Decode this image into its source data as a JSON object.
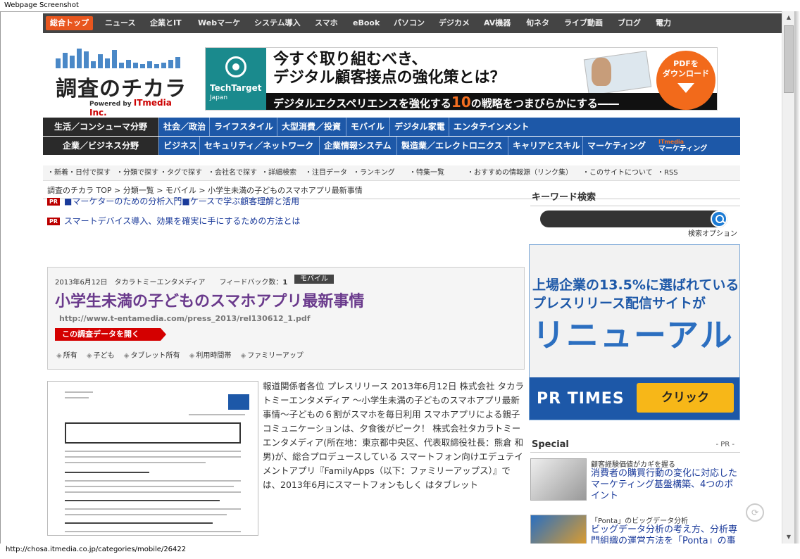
{
  "window": {
    "title": "Webpage Screenshot",
    "status_url": "http://chosa.itmedia.co.jp/categories/mobile/26422"
  },
  "topnav": [
    "総合トップ",
    "ニュース",
    "企業とIT",
    "Webマーケ",
    "システム導入",
    "スマホ",
    "eBook",
    "パソコン",
    "デジカメ",
    "AV機器",
    "旬ネタ",
    "ライブ動画",
    "ブログ",
    "電力"
  ],
  "logo": {
    "name": "調査のチカラ",
    "powered": "Powered by",
    "brand": "ITmedia Inc."
  },
  "banner": {
    "brand": "TechTarget",
    "brand_sub": "Japan",
    "headline1": "今すぐ取り組むべき、",
    "headline2": "デジタル顧客接点の強化策とは？",
    "strip_pre": "デジタルエクスペリエンスを強化する",
    "strip_num": "10",
    "strip_post": "の戦略をつまびらかにする――",
    "pdf_line1": "PDFを",
    "pdf_line2": "ダウンロード"
  },
  "consumer_row": {
    "head": "生活／コンシューマ分野",
    "items": [
      "社会／政治",
      "ライフスタイル",
      "大型消費／投資",
      "モバイル",
      "デジタル家電",
      "エンタテインメント"
    ]
  },
  "business_row": {
    "head": "企業／ビジネス分野",
    "items": [
      "ビジネス",
      "セキュリティ／ネットワーク",
      "企業情報システム",
      "製造業／エレクトロニクス",
      "キャリアとスキル",
      "マーケティング"
    ],
    "logo_top": "ITmedia",
    "logo_bottom": "マーケティング"
  },
  "subnav": [
    "・新着・日付で探す",
    "・分類で探す",
    "・タグで探す",
    "・会社名で探す",
    "・詳細検索",
    "・注目データ",
    "・ランキング",
    "・特集一覧",
    "・おすすめの情報源（リンク集）",
    "・このサイトについて",
    "・RSS"
  ],
  "breadcrumb": "調査のチカラ TOP > 分類一覧 > モバイル > 小学生未満の子どものスマホアプリ最新事情",
  "pr_links": [
    {
      "tag": "PR",
      "text": "■マーケターのための分析入門■ケースで学ぶ顧客理解と活用"
    },
    {
      "tag": "PR",
      "text": "スマートデバイス導入、効果を確実に手にするための方法とは"
    }
  ],
  "article": {
    "date": "2013年6月12日",
    "company": "タカラトミーエンタメディア",
    "feedback_label": "フィードバック数：",
    "feedback_count": "1",
    "category": "モバイル",
    "title": "小学生未満の子どものスマホアプリ最新事情",
    "url": "http://www.t-entamedia.com/press_2013/rel130612_1.pdf",
    "open_button": "この調査データを開く",
    "tags": [
      "所有",
      "子ども",
      "タブレット所有",
      "利用時間帯",
      "ファミリーアップ"
    ],
    "body": "報道関係者各位 プレスリリース 2013年6月12日 株式会社 タカラトミーエンタメディア ～小学生未満の子どものスマホアプリ最新事情～子どもの６割がスマホを毎日利用 スマホアプリによる親子コミュニケーションは、夕食後がピーク！ 株式会社タカラトミーエンタメディア(所在地：東京都中央区、代表取締役社長：熊倉 和男)が、総合プロデュースしている スマートフォン向けエデュテイメントアプリ『FamilyApps（以下：ファミリーアップス）』では、2013年6月にスマートフォンもしく はタブレット"
  },
  "sidebar": {
    "keyword_search": "キーワード検索",
    "search_placeholder": "",
    "search_option": "検索オプション",
    "ad": {
      "line1": "上場企業の13.5%に選ばれている",
      "line2": "プレスリリース配信サイトが",
      "line3": "リニューアル",
      "brand": "PR TIMES",
      "click": "クリック"
    },
    "special_title": "Special",
    "special_pr": "- PR -",
    "special_items": [
      {
        "kicker": "顧客経験価値がカギを握る",
        "title": "消費者の購買行動の変化に対応したマーケティング基盤構築、4つのポイント"
      },
      {
        "kicker": "「Ponta」のビッグデータ分析",
        "title": "ビッグデータ分析の考え方、分析専門組織の運営方法を「Ponta」の事例で解説"
      }
    ]
  },
  "colors": {
    "nav_dark": "#444444",
    "accent_orange": "#e8561e",
    "category_blue": "#1d58a8",
    "title_purple": "#6a3a8c",
    "link_blue": "#1a3a9a"
  }
}
